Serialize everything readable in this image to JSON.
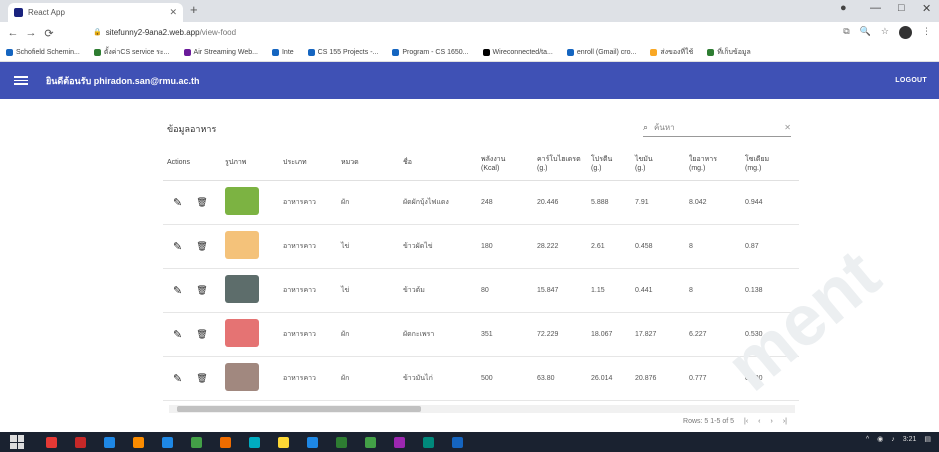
{
  "browser": {
    "tab_title": "React App",
    "url_host": "sitefunny2-9ana2.web.app",
    "url_path": "/view-food",
    "bookmarks": [
      {
        "label": "Schofield Schemin...",
        "color": "#1565c0"
      },
      {
        "label": "ตั้งค่าCS service ระ...",
        "color": "#2e7d32"
      },
      {
        "label": "Air Streaming Web...",
        "color": "#6a1b9a"
      },
      {
        "label": "Inte",
        "color": "#1565c0"
      },
      {
        "label": "CS 155 Projects -...",
        "color": "#1565c0"
      },
      {
        "label": "Program - CS 1650...",
        "color": "#1565c0"
      },
      {
        "label": "Wireconnected/ta...",
        "color": "#000000"
      },
      {
        "label": "enroll (Gmail) cro...",
        "color": "#1565c0"
      },
      {
        "label": "ส่งของที่ใช้",
        "color": "#f9a825"
      },
      {
        "label": "ที่เก็บข้อมูล",
        "color": "#2e7d32"
      }
    ]
  },
  "appbar": {
    "title": "ยินดีต้อนรับ phiradon.san@rmu.ac.th",
    "logout_label": "LOGOUT"
  },
  "table": {
    "title": "ข้อมูลอาหาร",
    "search_placeholder": "ค้นหา",
    "columns": [
      "Actions",
      "รูปภาพ",
      "ประเภท",
      "หมวด",
      "ชื่อ",
      "พลังงาน\n(Kcal)",
      "คาร์โบไฮเดรต\n(g.)",
      "โปรตีน\n(g.)",
      "ไขมัน\n(g.)",
      "ใยอาหาร\n(mg.)",
      "โซเดียม\n(mg.)"
    ],
    "rows": [
      {
        "thumb": "#7cb342",
        "type": "อาหารคาว",
        "cat": "ผัก",
        "name": "ผัดผักบุ้งไฟแดง",
        "kcal": "248",
        "carb": "20.446",
        "protein": "5.888",
        "fat": "7.91",
        "fiber": "8.042",
        "sodium": "0.944"
      },
      {
        "thumb": "#f4c27a",
        "type": "อาหารคาว",
        "cat": "ไข่",
        "name": "ข้าวผัดไข่",
        "kcal": "180",
        "carb": "28.222",
        "protein": "2.61",
        "fat": "0.458",
        "fiber": "8",
        "sodium": "0.87"
      },
      {
        "thumb": "#5d6d6b",
        "type": "อาหารคาว",
        "cat": "ไข่",
        "name": "ข้าวต้ม",
        "kcal": "80",
        "carb": "15.847",
        "protein": "1.15",
        "fat": "0.441",
        "fiber": "8",
        "sodium": "0.138"
      },
      {
        "thumb": "#e57373",
        "type": "อาหารคาว",
        "cat": "ผัก",
        "name": "ผัดกะเพรา",
        "kcal": "351",
        "carb": "72.229",
        "protein": "18.067",
        "fat": "17.827",
        "fiber": "6.227",
        "sodium": "0.530"
      },
      {
        "thumb": "#a1887f",
        "type": "อาหารคาว",
        "cat": "ผัก",
        "name": "ข้าวมันไก่",
        "kcal": "500",
        "carb": "63.80",
        "protein": "26.014",
        "fat": "20.876",
        "fiber": "0.777",
        "sodium": "0.890"
      }
    ],
    "pagination": "Rows: 5   1-5 of 5"
  },
  "watermark": "ment",
  "taskbar": {
    "clock": "3:21",
    "icons": [
      "#e53935",
      "#c62828",
      "#1e88e5",
      "#fb8c00",
      "#1e88e5",
      "#43a047",
      "#ef6c00",
      "#00acc1",
      "#fdd835",
      "#1e88e5",
      "#2e7d32",
      "#43a047",
      "#9c27b0",
      "#00897b",
      "#1565c0"
    ]
  }
}
